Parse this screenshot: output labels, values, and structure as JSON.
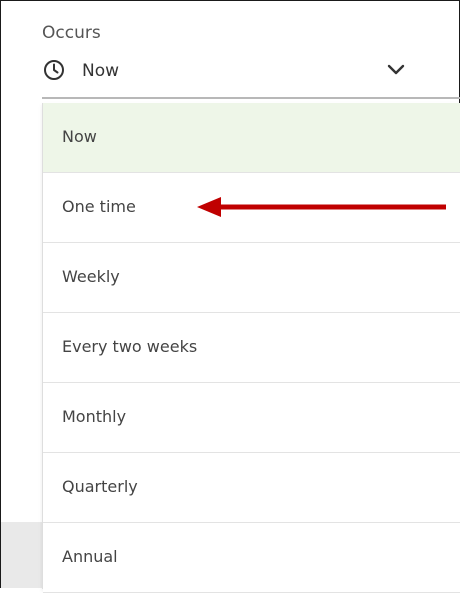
{
  "occurs_field": {
    "label": "Occurs",
    "selected_value": "Now",
    "icon": "clock-icon",
    "toggle_icon": "chevron-down-icon"
  },
  "dropdown": {
    "options": [
      {
        "label": "Now",
        "selected": true
      },
      {
        "label": "One time",
        "selected": false
      },
      {
        "label": "Weekly",
        "selected": false
      },
      {
        "label": "Every two weeks",
        "selected": false
      },
      {
        "label": "Monthly",
        "selected": false
      },
      {
        "label": "Quarterly",
        "selected": false
      },
      {
        "label": "Annual",
        "selected": false
      }
    ],
    "highlight_color": "#eef6e8"
  },
  "annotation": {
    "type": "arrow",
    "points_to": "One time",
    "color": "#c00000"
  }
}
